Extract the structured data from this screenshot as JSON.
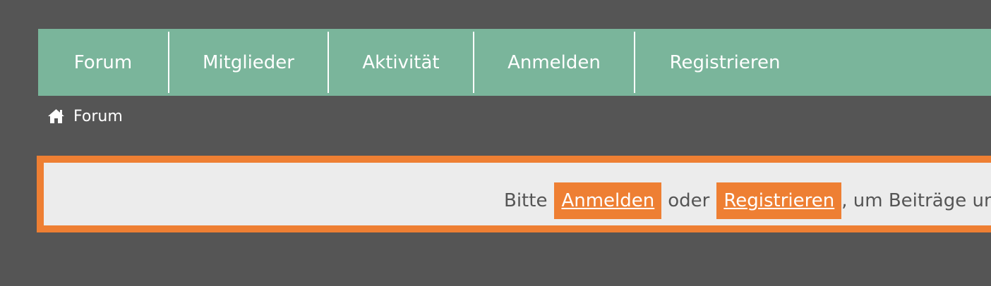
{
  "nav": {
    "items": [
      {
        "label": "Forum"
      },
      {
        "label": "Mitglieder"
      },
      {
        "label": "Aktivität"
      },
      {
        "label": "Anmelden"
      },
      {
        "label": "Registrieren"
      }
    ]
  },
  "breadcrumb": {
    "icon": "home-icon",
    "label": "Forum"
  },
  "notice": {
    "prefix": "Bitte",
    "login_label": "Anmelden",
    "middle": "oder",
    "register_label": "Registrieren",
    "suffix": ", um Beiträge und"
  },
  "colors": {
    "nav_bg": "#7ab59b",
    "accent": "#ee7f33",
    "page_bg": "#555555",
    "notice_bg": "#ececec"
  }
}
